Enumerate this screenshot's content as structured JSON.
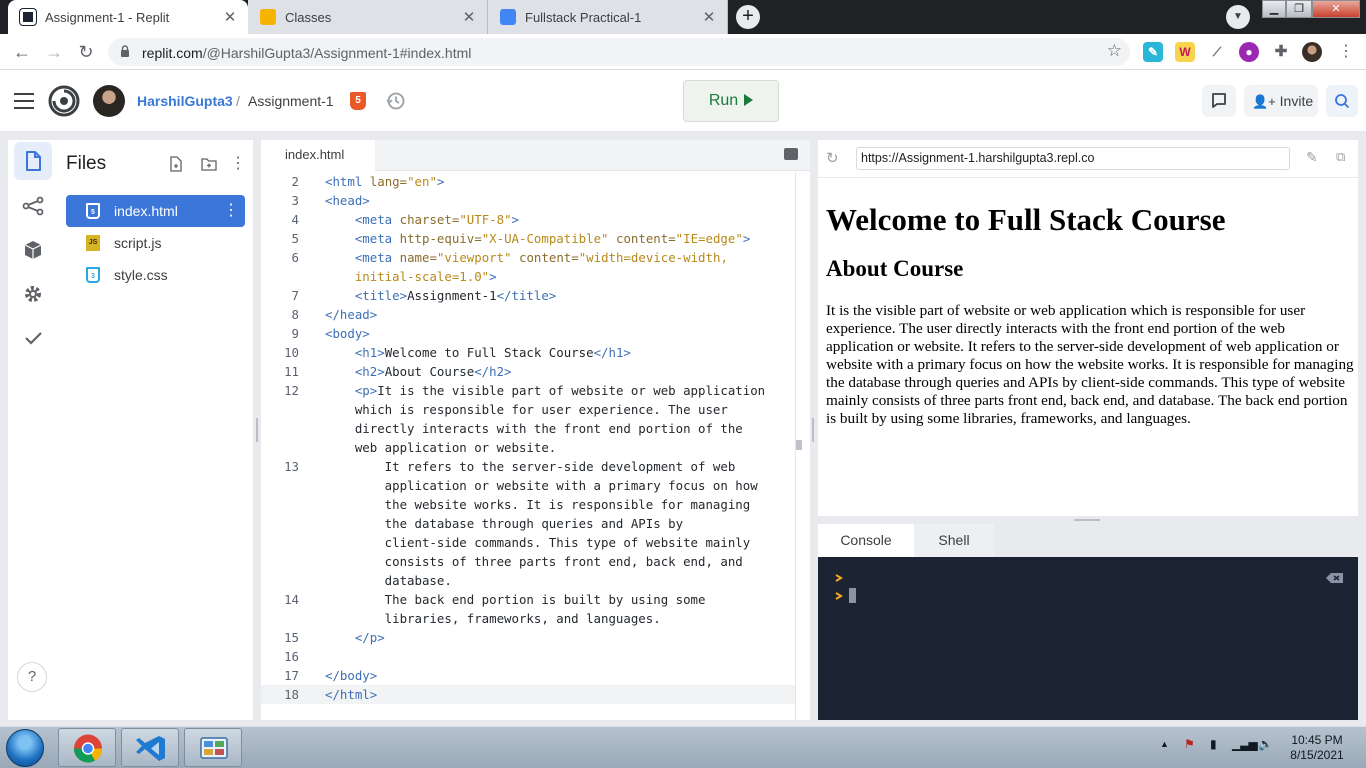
{
  "browser": {
    "tabs": [
      {
        "title": "Assignment-1 - Replit",
        "active": true
      },
      {
        "title": "Classes",
        "active": false
      },
      {
        "title": "Fullstack Practical-1",
        "active": false
      }
    ],
    "address": {
      "host": "replit.com",
      "path": "/@HarshilGupta3/Assignment-1#index.html"
    }
  },
  "header": {
    "username": "HarshilGupta3",
    "separator": "/",
    "repl_name": "Assignment-1",
    "run_label": "Run",
    "invite_label": "Invite"
  },
  "files": {
    "title": "Files",
    "items": [
      {
        "name": "index.html",
        "icon": "html-file-icon",
        "selected": true
      },
      {
        "name": "script.js",
        "icon": "js-file-icon",
        "selected": false
      },
      {
        "name": "style.css",
        "icon": "css-file-icon",
        "selected": false
      }
    ]
  },
  "editor": {
    "tab_label": "index.html",
    "lines": [
      {
        "n": "2",
        "html": "<span class=\"tg\">&lt;html</span> <span class=\"at\">lang=</span><span class=\"sv\">\"en\"</span><span class=\"tg\">&gt;</span>"
      },
      {
        "n": "3",
        "html": "<span class=\"tg\">&lt;head&gt;</span>"
      },
      {
        "n": "4",
        "html": "    <span class=\"tg\">&lt;meta</span> <span class=\"at\">charset=</span><span class=\"sv\">\"UTF-8\"</span><span class=\"tg\">&gt;</span>"
      },
      {
        "n": "5",
        "html": "    <span class=\"tg\">&lt;meta</span> <span class=\"at\">http-equiv=</span><span class=\"sv\">\"X-UA-Compatible\"</span> <span class=\"at\">content=</span><span class=\"sv\">\"IE=edge\"</span><span class=\"tg\">&gt;</span>"
      },
      {
        "n": "6",
        "html": "    <span class=\"tg\">&lt;meta</span> <span class=\"at\">name=</span><span class=\"sv\">\"viewport\"</span> <span class=\"at\">content=</span><span class=\"sv\">\"width=device-width,</span>"
      },
      {
        "n": "",
        "html": "    <span class=\"sv\">initial-scale=1.0\"</span><span class=\"tg\">&gt;</span>"
      },
      {
        "n": "7",
        "html": "    <span class=\"tg\">&lt;title&gt;</span>Assignment-1<span class=\"tg\">&lt;/title&gt;</span>"
      },
      {
        "n": "8",
        "html": "<span class=\"tg\">&lt;/head&gt;</span>"
      },
      {
        "n": "9",
        "html": "<span class=\"tg\">&lt;body&gt;</span>"
      },
      {
        "n": "10",
        "html": "    <span class=\"tg\">&lt;h1&gt;</span>Welcome to Full Stack Course<span class=\"tg\">&lt;/h1&gt;</span>"
      },
      {
        "n": "11",
        "html": "    <span class=\"tg\">&lt;h2&gt;</span>About Course<span class=\"tg\">&lt;/h2&gt;</span>"
      },
      {
        "n": "12",
        "html": "    <span class=\"tg\">&lt;p&gt;</span>It is the visible part of website or web application"
      },
      {
        "n": "",
        "html": "    which is responsible for user experience. The user"
      },
      {
        "n": "",
        "html": "    directly interacts with the front end portion of the"
      },
      {
        "n": "",
        "html": "    web application or website."
      },
      {
        "n": "13",
        "html": "        It refers to the server-side development of web"
      },
      {
        "n": "",
        "html": "        application or website with a primary focus on how"
      },
      {
        "n": "",
        "html": "        the website works. It is responsible for managing"
      },
      {
        "n": "",
        "html": "        the database through queries and APIs by"
      },
      {
        "n": "",
        "html": "        client-side commands. This type of website mainly"
      },
      {
        "n": "",
        "html": "        consists of three parts front end, back end, and"
      },
      {
        "n": "",
        "html": "        database."
      },
      {
        "n": "14",
        "html": "        The back end portion is built by using some"
      },
      {
        "n": "",
        "html": "        libraries, frameworks, and languages."
      },
      {
        "n": "15",
        "html": "    <span class=\"tg\">&lt;/p&gt;</span>"
      },
      {
        "n": "16",
        "html": ""
      },
      {
        "n": "17",
        "html": "<span class=\"tg\">&lt;/body&gt;</span>"
      },
      {
        "n": "18",
        "html": "<span class=\"tg\">&lt;/html&gt;</span>",
        "current": true
      }
    ]
  },
  "preview": {
    "url": "https://Assignment-1.harshilgupta3.repl.co",
    "h1": "Welcome to Full Stack Course",
    "h2": "About Course",
    "paragraph": "It is the visible part of website or web application which is responsible for user experience. The user directly interacts with the front end portion of the web application or website. It refers to the server-side development of web application or website with a primary focus on how the website works. It is responsible for managing the database through queries and APIs by client-side commands. This type of website mainly consists of three parts front end, back end, and database. The back end portion is built by using some libraries, frameworks, and languages."
  },
  "console": {
    "tabs": [
      "Console",
      "Shell"
    ],
    "active_tab": "Console"
  },
  "taskbar": {
    "time": "10:45 PM",
    "date": "8/15/2021"
  },
  "colors": {
    "accent_blue": "#3d76d9",
    "run_green": "#1a7b3c",
    "console_bg": "#1c2333",
    "prompt_orange": "#f5a623"
  }
}
